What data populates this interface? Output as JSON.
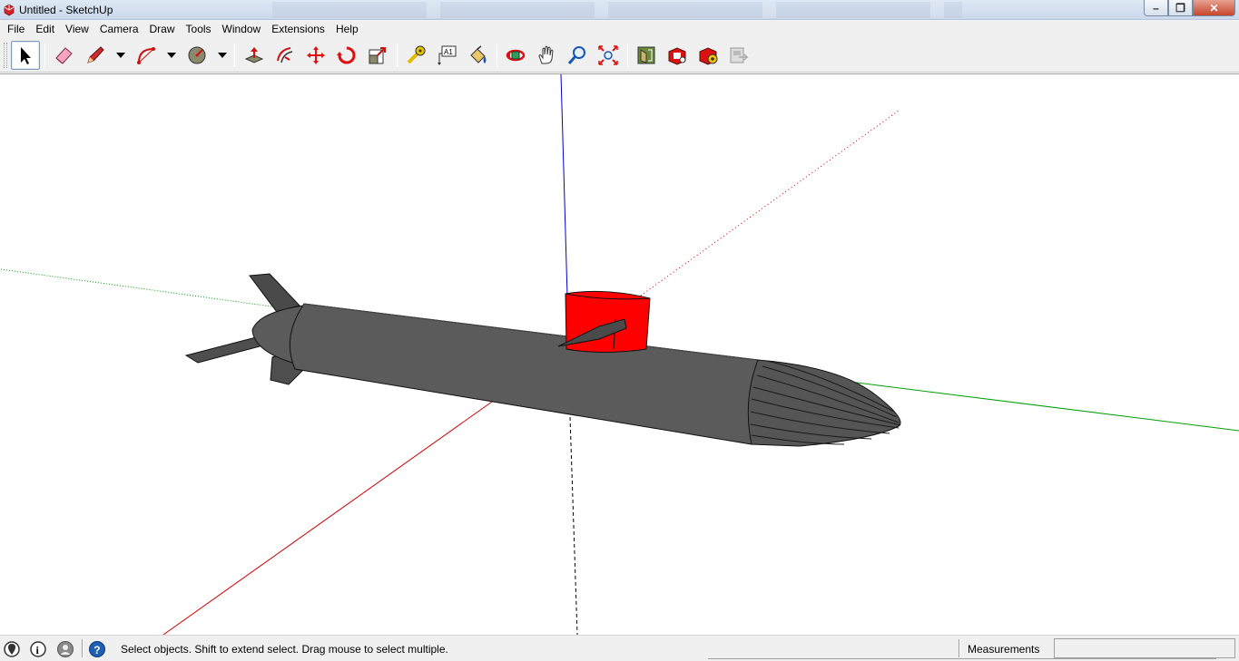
{
  "window": {
    "title": "Untitled - SketchUp",
    "min_glyph": "–",
    "max_glyph": "❐",
    "close_glyph": "✕"
  },
  "menu": [
    "File",
    "Edit",
    "View",
    "Camera",
    "Draw",
    "Tools",
    "Window",
    "Extensions",
    "Help"
  ],
  "toolbar": {
    "tools": [
      {
        "name": "select-tool-button",
        "icon": "cursor-arrow-icon",
        "active": true
      },
      {
        "name": "eraser-tool-button",
        "icon": "eraser-icon"
      },
      {
        "name": "pencil-tool-button",
        "icon": "pencil-icon"
      },
      {
        "name": "arc-tool-button",
        "icon": "arc-icon"
      },
      {
        "name": "shapes-tool-button",
        "icon": "circle-shape-icon"
      },
      {
        "name": "push-pull-button",
        "icon": "push-pull-icon"
      },
      {
        "name": "offset-button",
        "icon": "offset-icon"
      },
      {
        "name": "move-button",
        "icon": "move-arrows-icon"
      },
      {
        "name": "rotate-button",
        "icon": "rotate-icon"
      },
      {
        "name": "scale-button",
        "icon": "scale-icon"
      },
      {
        "name": "tape-measure-button",
        "icon": "tape-measure-icon"
      },
      {
        "name": "text-button",
        "icon": "text-label-icon"
      },
      {
        "name": "paint-bucket-button",
        "icon": "paint-bucket-icon"
      },
      {
        "name": "orbit-button",
        "icon": "orbit-icon"
      },
      {
        "name": "pan-button",
        "icon": "hand-icon"
      },
      {
        "name": "zoom-button",
        "icon": "magnifier-icon"
      },
      {
        "name": "zoom-extents-button",
        "icon": "zoom-extents-icon"
      },
      {
        "name": "warehouse-button",
        "icon": "3d-warehouse-icon"
      },
      {
        "name": "extension-warehouse-button",
        "icon": "extension-warehouse-icon"
      },
      {
        "name": "share-model-button",
        "icon": "share-model-icon"
      },
      {
        "name": "layout-button",
        "icon": "send-to-layout-icon"
      }
    ],
    "text_tool_glyph": "A1"
  },
  "colors": {
    "sub_body": "#5b5b5b",
    "sail": "#ff0000",
    "axis_red": "#cc0000",
    "axis_green": "#00a000",
    "axis_blue": "#0000cc",
    "accent_blue": "#1c5fb5"
  },
  "statusbar": {
    "message": "Select objects. Shift to extend select. Drag mouse to select multiple.",
    "measurements_label": "Measurements",
    "measurements_value": "",
    "help_glyph": "?",
    "info_glyph": "i"
  }
}
